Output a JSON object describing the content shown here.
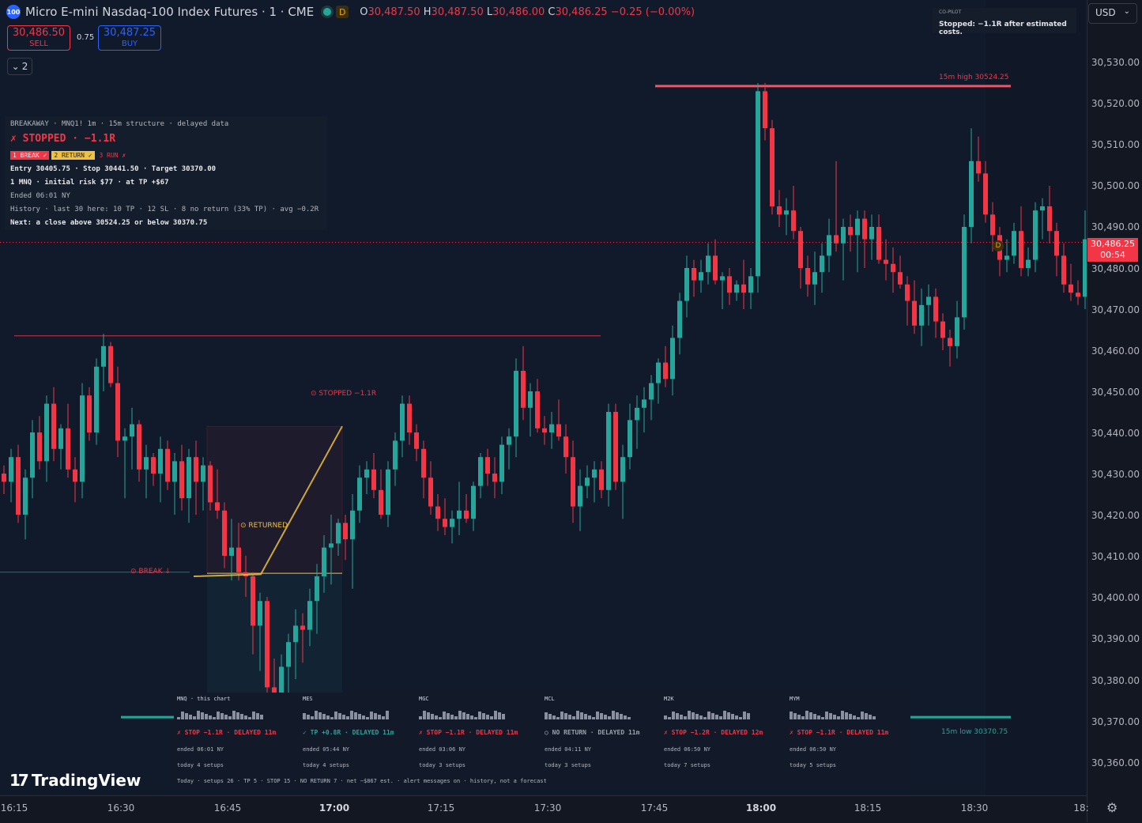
{
  "header": {
    "logo_text": "100",
    "title": "Micro E-mini Nasdaq-100 Index Futures · 1 · CME",
    "status_badge": "D",
    "ohlc": [
      {
        "key": "O",
        "value": "30,487.50"
      },
      {
        "key": "H",
        "value": "30,487.50"
      },
      {
        "key": "L",
        "value": "30,486.00"
      },
      {
        "key": "C",
        "value": "30,486.25"
      }
    ],
    "change": "−0.25 (−0.00%)"
  },
  "trade": {
    "sell_price": "30,486.50",
    "sell_label": "SELL",
    "spread": "0.75",
    "buy_price": "30,487.25",
    "buy_label": "BUY",
    "collapse_count": "2"
  },
  "info_panel": {
    "line1": "BREAKAWAY · MNQ1! 1m · 15m structure · delayed data",
    "status": "✗ STOPPED · −1.1R",
    "step1": "1 BREAK ✓",
    "step2": "2 RETURN ✓",
    "step3": "3 RUN ✗",
    "line_entry": "Entry 30405.75 · Stop 30441.50 · Target 30370.00",
    "line_risk": "1 MNQ · initial risk $77 · at TP +$67",
    "line_ended": "Ended 06:01 NY",
    "line_history": "History · last 30 here: 10 TP · 12 SL · 8 no return (33% TP) · avg −0.2R",
    "line_next": "Next: a close above 30524.25 or below 30370.75"
  },
  "copilot": {
    "title": "CO-PILOT",
    "message": "Stopped: −1.1R after estimated costs."
  },
  "currency": "USD",
  "price_badge": {
    "price": "30,486.25",
    "countdown": "00:54"
  },
  "markers": {
    "break": "⊙ BREAK ↓",
    "returned": "⊙ RETURNED",
    "stopped": "⊙ STOPPED −1.1R",
    "high_label": "15m high 30524.25",
    "low_label": "15m low 30370.75",
    "d_badge": "D"
  },
  "price_axis": [
    "30,530.00",
    "30,520.00",
    "30,510.00",
    "30,500.00",
    "30,490.00",
    "30,480.00",
    "30,470.00",
    "30,460.00",
    "30,450.00",
    "30,440.00",
    "30,430.00",
    "30,420.00",
    "30,410.00",
    "30,400.00",
    "30,390.00",
    "30,380.00",
    "30,370.00",
    "30,360.00"
  ],
  "time_axis": [
    {
      "t": "16:15",
      "b": false
    },
    {
      "t": "16:30",
      "b": false
    },
    {
      "t": "16:45",
      "b": false
    },
    {
      "t": "17:00",
      "b": true
    },
    {
      "t": "17:15",
      "b": false
    },
    {
      "t": "17:30",
      "b": false
    },
    {
      "t": "17:45",
      "b": false
    },
    {
      "t": "18:00",
      "b": true
    },
    {
      "t": "18:15",
      "b": false
    },
    {
      "t": "18:30",
      "b": false
    },
    {
      "t": "18:",
      "b": false
    }
  ],
  "bottom_panel": {
    "columns": [
      {
        "name": "MNQ · this chart",
        "result": "✗ STOP −1.1R · DELAYED 11m",
        "ended": "ended 06:01 NY",
        "today": "today 4 setups",
        "color": "#f23645"
      },
      {
        "name": "MES",
        "result": "✓ TP +0.8R · DELAYED 11m",
        "ended": "ended 05:44 NY",
        "today": "today 4 setups",
        "color": "#26a69a"
      },
      {
        "name": "MGC",
        "result": "✗ STOP −1.1R · DELAYED 11m",
        "ended": "ended 03:06 NY",
        "today": "today 3 setups",
        "color": "#f23645"
      },
      {
        "name": "MCL",
        "result": "○ NO RETURN · DELAYED 11m",
        "ended": "ended 04:11 NY",
        "today": "today 3 setups",
        "color": "#9aa0ab"
      },
      {
        "name": "M2K",
        "result": "✗ STOP −1.2R · DELAYED 12m",
        "ended": "ended 06:50 NY",
        "today": "today 7 setups",
        "color": "#f23645"
      },
      {
        "name": "MYM",
        "result": "✗ STOP −1.1R · DELAYED 11m",
        "ended": "ended 06:50 NY",
        "today": "today 5 setups",
        "color": "#f23645"
      }
    ],
    "summary": "Today · setups 26 · TP 5 · STOP 15 · NO RETURN 7 · net −$867 est. · alert messages on · history, not a forecast"
  },
  "branding": "TradingView",
  "colors": {
    "up": "#26a69a",
    "down": "#f23645",
    "accent": "#2962ff",
    "return": "#f0c040"
  },
  "chart_data": {
    "type": "candlestick",
    "interval": "1m",
    "ylim": [
      30355,
      30538
    ],
    "levels": {
      "high_15m": 30524.25,
      "low_15m": 30370.75,
      "current": 30486.25,
      "entry": 30405.75,
      "stop": 30441.5,
      "target": 30370.0,
      "previous_high": 30463.5,
      "break_level": 30406
    },
    "ohlc": [
      [
        30430,
        30432,
        30425,
        30428
      ],
      [
        30428,
        30436,
        30423,
        30434
      ],
      [
        30434,
        30437,
        30418,
        30420
      ],
      [
        30420,
        30431,
        30414,
        30429
      ],
      [
        30429,
        30443,
        30424,
        30440
      ],
      [
        30440,
        30444,
        30431,
        30433
      ],
      [
        30433,
        30449,
        30428,
        30447
      ],
      [
        30447,
        30451,
        30433,
        30436
      ],
      [
        30436,
        30442,
        30431,
        30441
      ],
      [
        30441,
        30447,
        30429,
        30431
      ],
      [
        30431,
        30434,
        30423,
        30428
      ],
      [
        30428,
        30452,
        30424,
        30449
      ],
      [
        30449,
        30451,
        30438,
        30440
      ],
      [
        30440,
        30458,
        30437,
        30456
      ],
      [
        30456,
        30464,
        30450,
        30461
      ],
      [
        30461,
        30462,
        30451,
        30452
      ],
      [
        30452,
        30456,
        30434,
        30438
      ],
      [
        30438,
        30441,
        30424,
        30439
      ],
      [
        30439,
        30446,
        30431,
        30442
      ],
      [
        30442,
        30443,
        30428,
        30431
      ],
      [
        30431,
        30437,
        30424,
        30434
      ],
      [
        30434,
        30435,
        30427,
        30430
      ],
      [
        30430,
        30439,
        30423,
        30436
      ],
      [
        30436,
        30438,
        30426,
        30428
      ],
      [
        30428,
        30435,
        30420,
        30433
      ],
      [
        30433,
        30437,
        30421,
        30424
      ],
      [
        30424,
        30436,
        30418,
        30434
      ],
      [
        30434,
        30438,
        30420,
        30428
      ],
      [
        30428,
        30434,
        30421,
        30432
      ],
      [
        30432,
        30433,
        30421,
        30423
      ],
      [
        30423,
        30431,
        30419,
        30421
      ],
      [
        30421,
        30423,
        30407,
        30410
      ],
      [
        30410,
        30419,
        30404,
        30412
      ],
      [
        30412,
        30418,
        30404,
        30406
      ],
      [
        30406,
        30410,
        30400,
        30405
      ],
      [
        30405,
        30406,
        30386,
        30393
      ],
      [
        30393,
        30401,
        30382,
        30399
      ],
      [
        30399,
        30400,
        30375,
        30378
      ],
      [
        30378,
        30385,
        30372,
        30374
      ],
      [
        30374,
        30386,
        30372,
        30383
      ],
      [
        30383,
        30391,
        30374,
        30389
      ],
      [
        30389,
        30397,
        30380,
        30393
      ],
      [
        30393,
        30396,
        30384,
        30392
      ],
      [
        30392,
        30402,
        30388,
        30399
      ],
      [
        30399,
        30408,
        30391,
        30405
      ],
      [
        30405,
        30415,
        30401,
        30412
      ],
      [
        30412,
        30420,
        30403,
        30413
      ],
      [
        30413,
        30419,
        30410,
        30418
      ],
      [
        30418,
        30420,
        30409,
        30414
      ],
      [
        30414,
        30425,
        30402,
        30421
      ],
      [
        30421,
        30432,
        30418,
        30429
      ],
      [
        30429,
        30433,
        30425,
        30431
      ],
      [
        30431,
        30435,
        30424,
        30426
      ],
      [
        30426,
        30431,
        30419,
        30420
      ],
      [
        30420,
        30433,
        30417,
        30431
      ],
      [
        30431,
        30440,
        30427,
        30438
      ],
      [
        30438,
        30449,
        30434,
        30447
      ],
      [
        30447,
        30449,
        30437,
        30440
      ],
      [
        30440,
        30442,
        30433,
        30436
      ],
      [
        30436,
        30438,
        30424,
        30429
      ],
      [
        30429,
        30433,
        30420,
        30422
      ],
      [
        30422,
        30425,
        30416,
        30419
      ],
      [
        30419,
        30424,
        30415,
        30417
      ],
      [
        30417,
        30421,
        30413,
        30419
      ],
      [
        30419,
        30428,
        30415,
        30421
      ],
      [
        30421,
        30425,
        30418,
        30419
      ],
      [
        30419,
        30428,
        30416,
        30427
      ],
      [
        30427,
        30435,
        30424,
        30434
      ],
      [
        30434,
        30436,
        30427,
        30430
      ],
      [
        30430,
        30434,
        30424,
        30428
      ],
      [
        30428,
        30439,
        30425,
        30437
      ],
      [
        30437,
        30441,
        30431,
        30439
      ],
      [
        30439,
        30458,
        30434,
        30455
      ],
      [
        30455,
        30461,
        30443,
        30446
      ],
      [
        30446,
        30452,
        30439,
        30450
      ],
      [
        30450,
        30453,
        30440,
        30441
      ],
      [
        30441,
        30444,
        30437,
        30440
      ],
      [
        30440,
        30445,
        30436,
        30442
      ],
      [
        30442,
        30448,
        30438,
        30439
      ],
      [
        30439,
        30442,
        30430,
        30434
      ],
      [
        30434,
        30438,
        30418,
        30422
      ],
      [
        30422,
        30431,
        30416,
        30427
      ],
      [
        30427,
        30432,
        30424,
        30429
      ],
      [
        30429,
        30433,
        30423,
        30431
      ],
      [
        30431,
        30433,
        30424,
        30426
      ],
      [
        30426,
        30447,
        30422,
        30445
      ],
      [
        30445,
        30447,
        30426,
        30428
      ],
      [
        30428,
        30437,
        30419,
        30434
      ],
      [
        30434,
        30447,
        30431,
        30443
      ],
      [
        30443,
        30449,
        30436,
        30446
      ],
      [
        30446,
        30451,
        30440,
        30448
      ],
      [
        30448,
        30454,
        30443,
        30452
      ],
      [
        30452,
        30458,
        30447,
        30457
      ],
      [
        30457,
        30461,
        30451,
        30453
      ],
      [
        30453,
        30466,
        30449,
        30463
      ],
      [
        30463,
        30474,
        30459,
        30472
      ],
      [
        30472,
        30483,
        30468,
        30480
      ],
      [
        30480,
        30482,
        30473,
        30477
      ],
      [
        30477,
        30482,
        30474,
        30479
      ],
      [
        30479,
        30486,
        30476,
        30483
      ],
      [
        30483,
        30487,
        30476,
        30477
      ],
      [
        30477,
        30479,
        30470,
        30478
      ],
      [
        30478,
        30480,
        30471,
        30474
      ],
      [
        30474,
        30477,
        30472,
        30476
      ],
      [
        30476,
        30482,
        30470,
        30474
      ],
      [
        30474,
        30480,
        30470,
        30478
      ],
      [
        30478,
        30525,
        30474,
        30523
      ],
      [
        30523,
        30525,
        30511,
        30514
      ],
      [
        30514,
        30516,
        30493,
        30495
      ],
      [
        30495,
        30499,
        30490,
        30493
      ],
      [
        30493,
        30497,
        30488,
        30494
      ],
      [
        30494,
        30500,
        30487,
        30489
      ],
      [
        30489,
        30490,
        30475,
        30480
      ],
      [
        30480,
        30483,
        30473,
        30476
      ],
      [
        30476,
        30484,
        30471,
        30479
      ],
      [
        30479,
        30486,
        30474,
        30483
      ],
      [
        30483,
        30492,
        30479,
        30488
      ],
      [
        30488,
        30506,
        30484,
        30486
      ],
      [
        30486,
        30492,
        30477,
        30490
      ],
      [
        30490,
        30493,
        30484,
        30488
      ],
      [
        30488,
        30494,
        30479,
        30492
      ],
      [
        30492,
        30494,
        30480,
        30487
      ],
      [
        30487,
        30493,
        30482,
        30490
      ],
      [
        30490,
        30493,
        30481,
        30482
      ],
      [
        30482,
        30487,
        30477,
        30481
      ],
      [
        30481,
        30485,
        30474,
        30479
      ],
      [
        30479,
        30483,
        30475,
        30476
      ],
      [
        30476,
        30478,
        30466,
        30472
      ],
      [
        30472,
        30477,
        30464,
        30466
      ],
      [
        30466,
        30475,
        30461,
        30471
      ],
      [
        30471,
        30476,
        30466,
        30473
      ],
      [
        30473,
        30475,
        30463,
        30467
      ],
      [
        30467,
        30469,
        30460,
        30463
      ],
      [
        30463,
        30465,
        30456,
        30461
      ],
      [
        30461,
        30472,
        30458,
        30468
      ],
      [
        30468,
        30493,
        30465,
        30490
      ],
      [
        30490,
        30514,
        30486,
        30506
      ],
      [
        30506,
        30512,
        30501,
        30503
      ],
      [
        30503,
        30506,
        30491,
        30493
      ],
      [
        30493,
        30496,
        30484,
        30488
      ],
      [
        30488,
        30490,
        30478,
        30482
      ],
      [
        30482,
        30487,
        30479,
        30483
      ],
      [
        30483,
        30491,
        30481,
        30489
      ],
      [
        30489,
        30495,
        30478,
        30480
      ],
      [
        30480,
        30485,
        30478,
        30482
      ],
      [
        30482,
        30496,
        30479,
        30494
      ],
      [
        30494,
        30497,
        30487,
        30495
      ],
      [
        30495,
        30500,
        30486,
        30489
      ],
      [
        30489,
        30491,
        30478,
        30483
      ],
      [
        30483,
        30486,
        30474,
        30476
      ],
      [
        30476,
        30481,
        30472,
        30474
      ],
      [
        30474,
        30477,
        30471,
        30473
      ],
      [
        30473,
        30494,
        30470,
        30487
      ],
      [
        30487,
        30488,
        30486,
        30486.25
      ]
    ]
  }
}
